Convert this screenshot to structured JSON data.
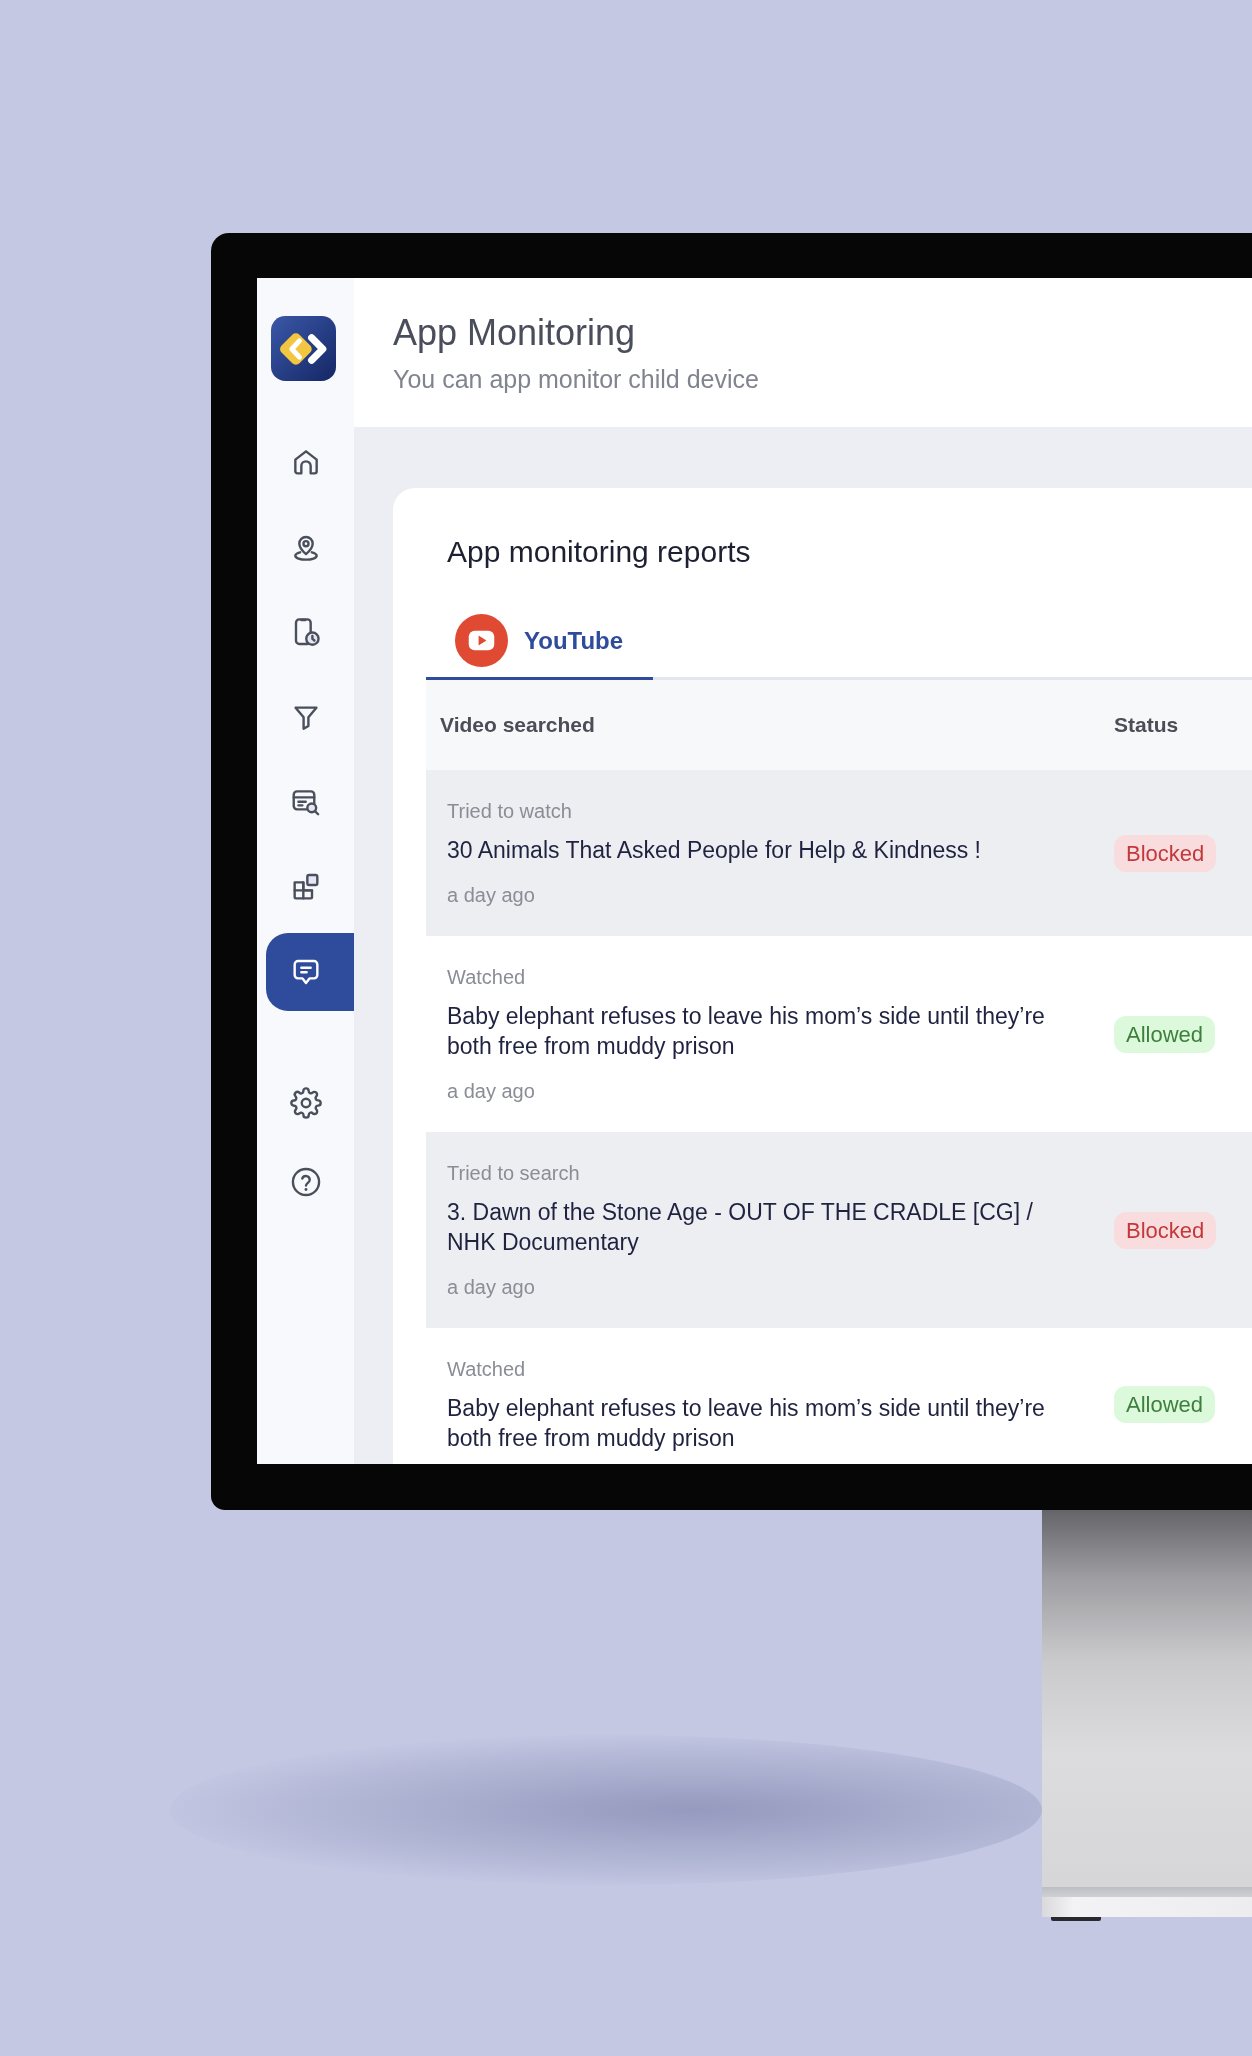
{
  "header": {
    "title": "App Monitoring",
    "subtitle": "You can app monitor child device"
  },
  "sidebar": {
    "nav_items": [
      {
        "selected": false
      },
      {
        "selected": false
      },
      {
        "selected": false
      },
      {
        "selected": false
      },
      {
        "selected": false
      },
      {
        "selected": false
      },
      {
        "selected": true
      }
    ],
    "footer_items": [
      {
        "selected": false
      },
      {
        "selected": false
      }
    ]
  },
  "card": {
    "title": "App monitoring reports",
    "tabs": [
      {
        "label": "YouTube",
        "selected": true
      }
    ],
    "table": {
      "columns": [
        "Video searched",
        "Status"
      ],
      "rows": [
        {
          "action": "Tried to watch",
          "title": "30 Animals That Asked People for Help & Kindness !",
          "time": "a day ago",
          "status": {
            "label": "Blocked",
            "color": "#c2383b"
          }
        },
        {
          "action": "Watched",
          "title": "Baby elephant refuses to leave his mom’s side until they’re both free from muddy prison",
          "time": "a day ago",
          "status": {
            "label": "Allowed",
            "color": "#3d7f3c"
          }
        },
        {
          "action": "Tried to search",
          "title": "3. Dawn of the Stone Age - OUT OF THE CRADLE [CG] / NHK Documentary",
          "time": "a day ago",
          "status": {
            "label": "Blocked",
            "color": "#c2383b"
          }
        },
        {
          "action": "Watched",
          "title": "Baby elephant refuses to leave his mom’s side until they’re both free from muddy prison",
          "status": {
            "label": "Allowed",
            "color": "#3d7f3c"
          }
        }
      ]
    }
  }
}
